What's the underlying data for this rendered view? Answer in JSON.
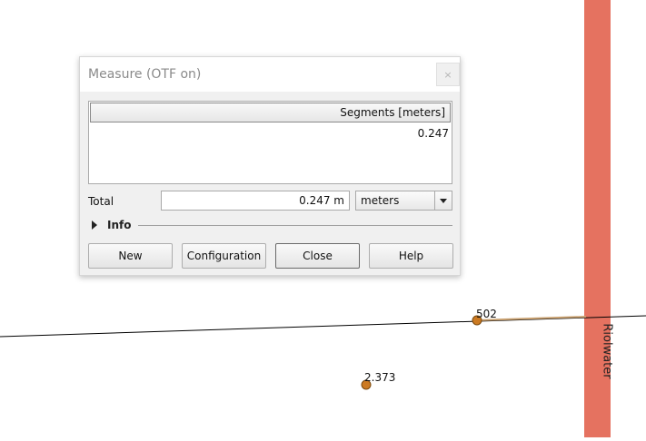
{
  "map": {
    "road_label": "Riolwater",
    "points": [
      {
        "label": "502"
      },
      {
        "label": "2.373"
      }
    ],
    "colors": {
      "road": "#e57260",
      "measure_line": "#c8a070",
      "point_fill": "#cc7a22",
      "line": "#000000"
    }
  },
  "dialog": {
    "title": "Measure (OTF on)",
    "close_glyph": "×",
    "segments": {
      "header": "Segments [meters]",
      "rows": [
        "0.247"
      ]
    },
    "total": {
      "label": "Total",
      "value": "0.247 m",
      "unit": "meters"
    },
    "info_label": "Info",
    "buttons": {
      "new": "New",
      "configuration": "Configuration",
      "close": "Close",
      "help": "Help"
    }
  }
}
